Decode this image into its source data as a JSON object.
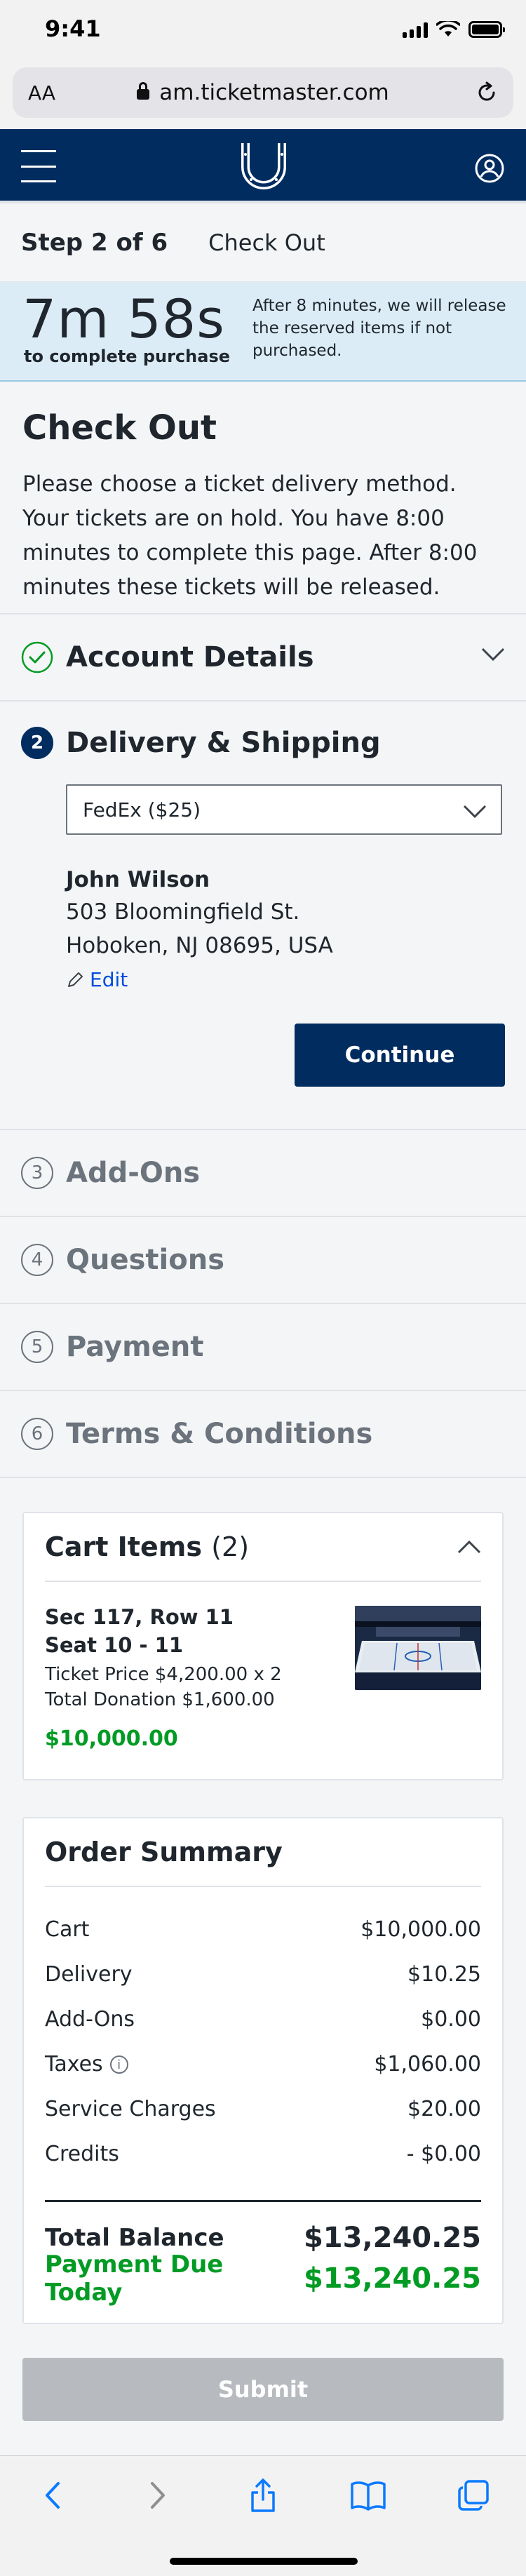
{
  "status_bar": {
    "time": "9:41"
  },
  "browser": {
    "aa_label": "AA",
    "url": "am.ticketmaster.com"
  },
  "step": {
    "progress": "Step 2 of 6",
    "label": "Check Out"
  },
  "timer": {
    "value": "7m 58s",
    "caption": "to complete purchase",
    "note": "After 8 minutes, we will release the reserved items if not purchased."
  },
  "checkout": {
    "title": "Check Out",
    "intro": "Please choose a ticket delivery method. Your tickets are on hold. You have 8:00 minutes to complete this page. After 8:00 minutes these tickets will be released."
  },
  "sections": {
    "account": {
      "title": "Account Details"
    },
    "delivery": {
      "number": "2",
      "title": "Delivery & Shipping",
      "selected_method": "FedEx ($25)",
      "name": "John Wilson",
      "address_line1": "503 Bloomingfield St.",
      "address_line2": "Hoboken, NJ 08695, USA",
      "edit_label": "Edit",
      "continue_label": "Continue"
    },
    "addons": {
      "number": "3",
      "title": "Add-Ons"
    },
    "questions": {
      "number": "4",
      "title": "Questions"
    },
    "payment": {
      "number": "5",
      "title": "Payment"
    },
    "terms": {
      "number": "6",
      "title": "Terms & Conditions"
    }
  },
  "cart": {
    "title": "Cart Items",
    "count": "(2)",
    "item": {
      "section_row": "Sec 117, Row 11",
      "seats": "Seat 10 - 11",
      "ticket_price": "Ticket Price $4,200.00 x 2",
      "donation": "Total Donation $1,600.00",
      "total": "$10,000.00"
    }
  },
  "summary": {
    "title": "Order Summary",
    "rows": [
      {
        "label": "Cart",
        "value": "$10,000.00"
      },
      {
        "label": "Delivery",
        "value": "$10.25"
      },
      {
        "label": "Add-Ons",
        "value": "$0.00"
      },
      {
        "label": "Taxes",
        "value": "$1,060.00"
      },
      {
        "label": "Service Charges",
        "value": "$20.00"
      },
      {
        "label": "Credits",
        "value": "- $0.00"
      }
    ],
    "total_label": "Total Balance",
    "total_value": "$13,240.25",
    "due_label": "Payment Due Today",
    "due_value": "$13,240.25",
    "info_glyph": "i"
  },
  "submit_label": "Submit",
  "colors": {
    "brand_navy": "#002c5f",
    "timer_bg": "#dcecf6",
    "success_green": "#029b24",
    "link_blue": "#024ddf",
    "disabled_gray": "#b7bbbf"
  },
  "icons": [
    "lock-icon",
    "reload-icon",
    "hamburger-icon",
    "horseshoe-logo",
    "account-icon",
    "check-circle-icon",
    "chevron-down-icon",
    "chevron-up-icon",
    "pencil-icon",
    "info-icon",
    "back-icon",
    "forward-icon",
    "share-icon",
    "bookmarks-icon",
    "tabs-icon"
  ]
}
